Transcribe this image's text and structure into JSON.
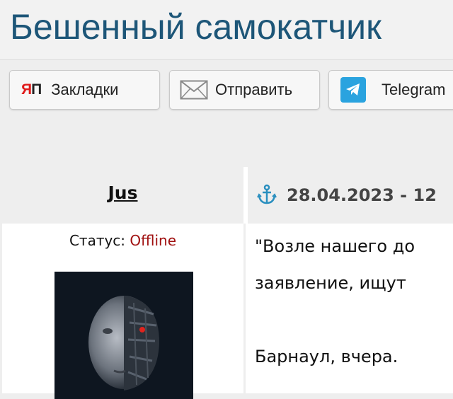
{
  "page": {
    "title": "Бешенный самокатчик"
  },
  "share": {
    "bookmarks": {
      "icon_text_ya": "ЯП",
      "label": "Закладки"
    },
    "send": {
      "icon": "envelope-icon",
      "label": "Отправить"
    },
    "telegram": {
      "icon": "telegram-icon",
      "label": "Telegram"
    }
  },
  "post": {
    "author": "Jus",
    "date": "28.04.2023 - 12",
    "status_label": "Статус:",
    "status_value": "Offline",
    "lines": [
      "\"Возле нашего до",
      "заявление, ищут",
      "",
      "Барнаул, вчера."
    ]
  },
  "colors": {
    "title": "#1d5678",
    "status_offline": "#a01010",
    "telegram": "#2aa3df",
    "yandex_red": "#e01b1b",
    "anchor": "#2a8fbf"
  }
}
